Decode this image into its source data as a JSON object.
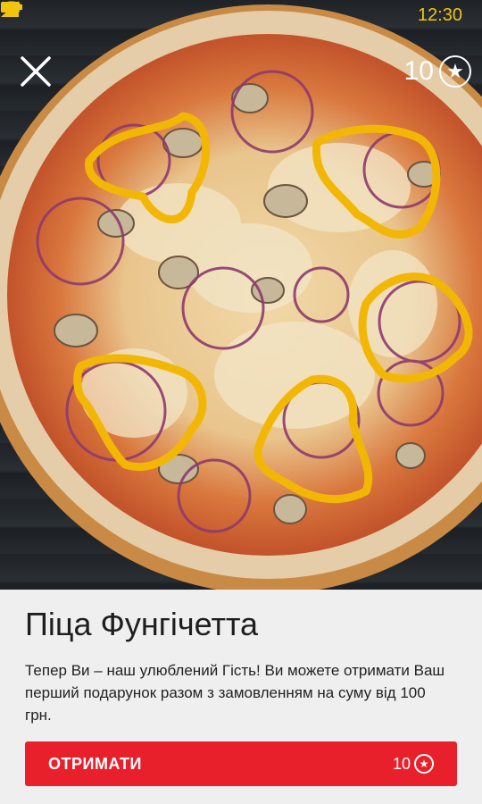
{
  "status_bar": {
    "time": "12:30",
    "icons": [
      "wifi-icon",
      "signal-icon",
      "battery-icon"
    ],
    "color": "#f1c40f"
  },
  "header": {
    "close_icon": "close-icon",
    "points": "10",
    "points_icon": "star-icon"
  },
  "product": {
    "title": "Піца Фунгічетта",
    "description": "Тепер Ви – наш улюблений Гість!  Ви можете отримати Ваш перший подарунок разом з замовленням на суму від 100 грн."
  },
  "action": {
    "label": "ОТРИМАТИ",
    "points": "10",
    "points_icon": "star-icon",
    "color": "#e8202b"
  }
}
